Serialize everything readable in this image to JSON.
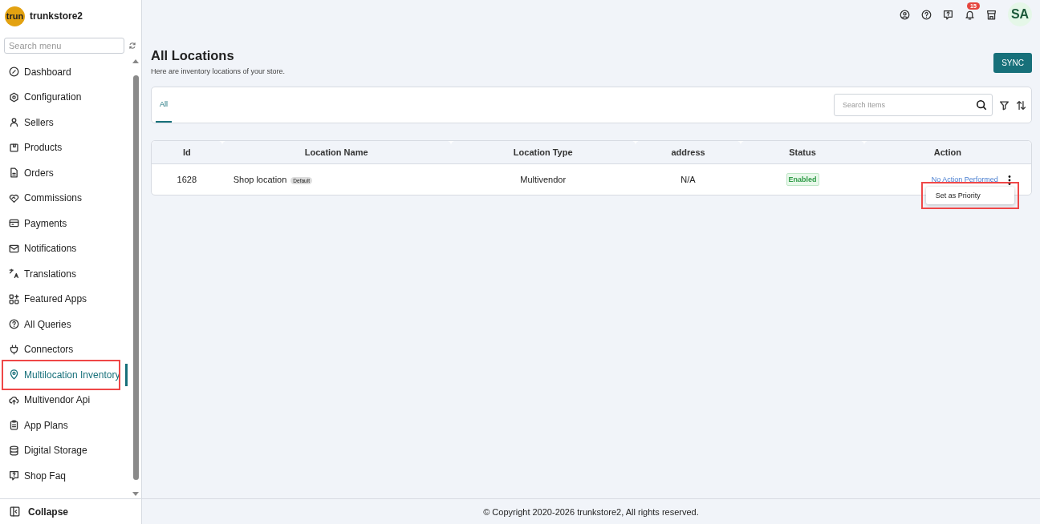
{
  "store": {
    "avatar_text": "trun",
    "name": "trunkstore2"
  },
  "sidebar": {
    "search_placeholder": "Search menu",
    "items": [
      {
        "label": "Dashboard",
        "selected": false,
        "highlighted": false
      },
      {
        "label": "Configuration",
        "selected": false,
        "highlighted": false
      },
      {
        "label": "Sellers",
        "selected": false,
        "highlighted": false
      },
      {
        "label": "Products",
        "selected": false,
        "highlighted": false
      },
      {
        "label": "Orders",
        "selected": false,
        "highlighted": false
      },
      {
        "label": "Commissions",
        "selected": false,
        "highlighted": false
      },
      {
        "label": "Payments",
        "selected": false,
        "highlighted": false
      },
      {
        "label": "Notifications",
        "selected": false,
        "highlighted": false
      },
      {
        "label": "Translations",
        "selected": false,
        "highlighted": false
      },
      {
        "label": "Featured Apps",
        "selected": false,
        "highlighted": false
      },
      {
        "label": "All Queries",
        "selected": false,
        "highlighted": false
      },
      {
        "label": "Connectors",
        "selected": false,
        "highlighted": false
      },
      {
        "label": "Multilocation Inventory",
        "selected": true,
        "highlighted": true
      },
      {
        "label": "Multivendor Api",
        "selected": false,
        "highlighted": false
      },
      {
        "label": "App Plans",
        "selected": false,
        "highlighted": false
      },
      {
        "label": "Digital Storage",
        "selected": false,
        "highlighted": false
      },
      {
        "label": "Shop Faq",
        "selected": false,
        "highlighted": false
      }
    ],
    "collapse_label": "Collapse"
  },
  "topbar": {
    "notification_count": "15",
    "user_initials": "SA"
  },
  "page": {
    "title": "All Locations",
    "subtitle": "Here are inventory locations of your store.",
    "sync_button": "SYNC"
  },
  "tabs": [
    {
      "label": "All",
      "selected": true
    }
  ],
  "search": {
    "placeholder": "Search Items"
  },
  "table": {
    "columns": [
      "Id",
      "Location Name",
      "Location Type",
      "address",
      "Status",
      "Action"
    ],
    "rows": [
      {
        "id": "1628",
        "name": "Shop location",
        "badge": "Default",
        "type": "Multivendor",
        "address": "N/A",
        "status": "Enabled",
        "action": "No Action Performed"
      }
    ]
  },
  "action_menu": {
    "items": [
      "Set as Priority"
    ],
    "highlighted": true
  },
  "footer": "© Copyright 2020-2026 trunkstore2, All rights reserved."
}
